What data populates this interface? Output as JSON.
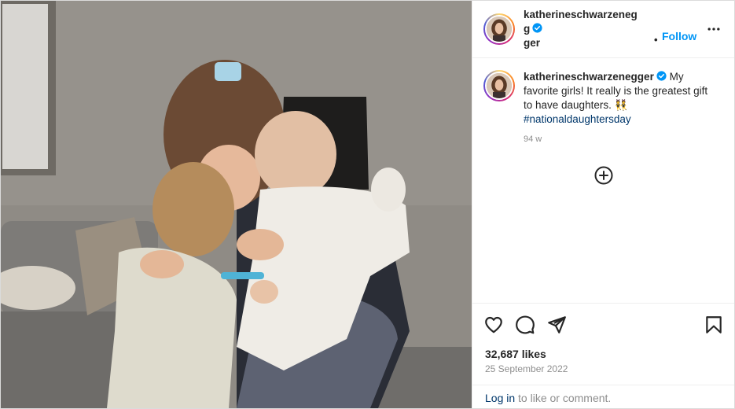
{
  "post": {
    "username": "katherineschwarzenegger",
    "username_line1": "katherineschwarzenegg",
    "username_line2": "ger",
    "separator": "•",
    "follow_label": "Follow",
    "caption": {
      "username": "katherineschwarzenegger",
      "text": " My favorite girls! It really is the greatest gift to have daughters. 👯",
      "hashtag": "#nationaldaughtersday",
      "time_ago": "94 w"
    },
    "likes": "32,687 likes",
    "date": "25 September 2022",
    "login_link": "Log in",
    "login_suffix": " to like or comment."
  },
  "colors": {
    "accent": "#0095f6",
    "hashtag": "#00376b",
    "secondary_text": "#8e8e8e",
    "verified": "#0095f6"
  },
  "icons": {
    "more": "more-horizontal-icon",
    "load_more": "plus-circle-icon",
    "like": "heart-icon",
    "comment": "comment-icon",
    "share": "paper-plane-icon",
    "save": "bookmark-icon",
    "verified": "verified-badge-icon"
  }
}
